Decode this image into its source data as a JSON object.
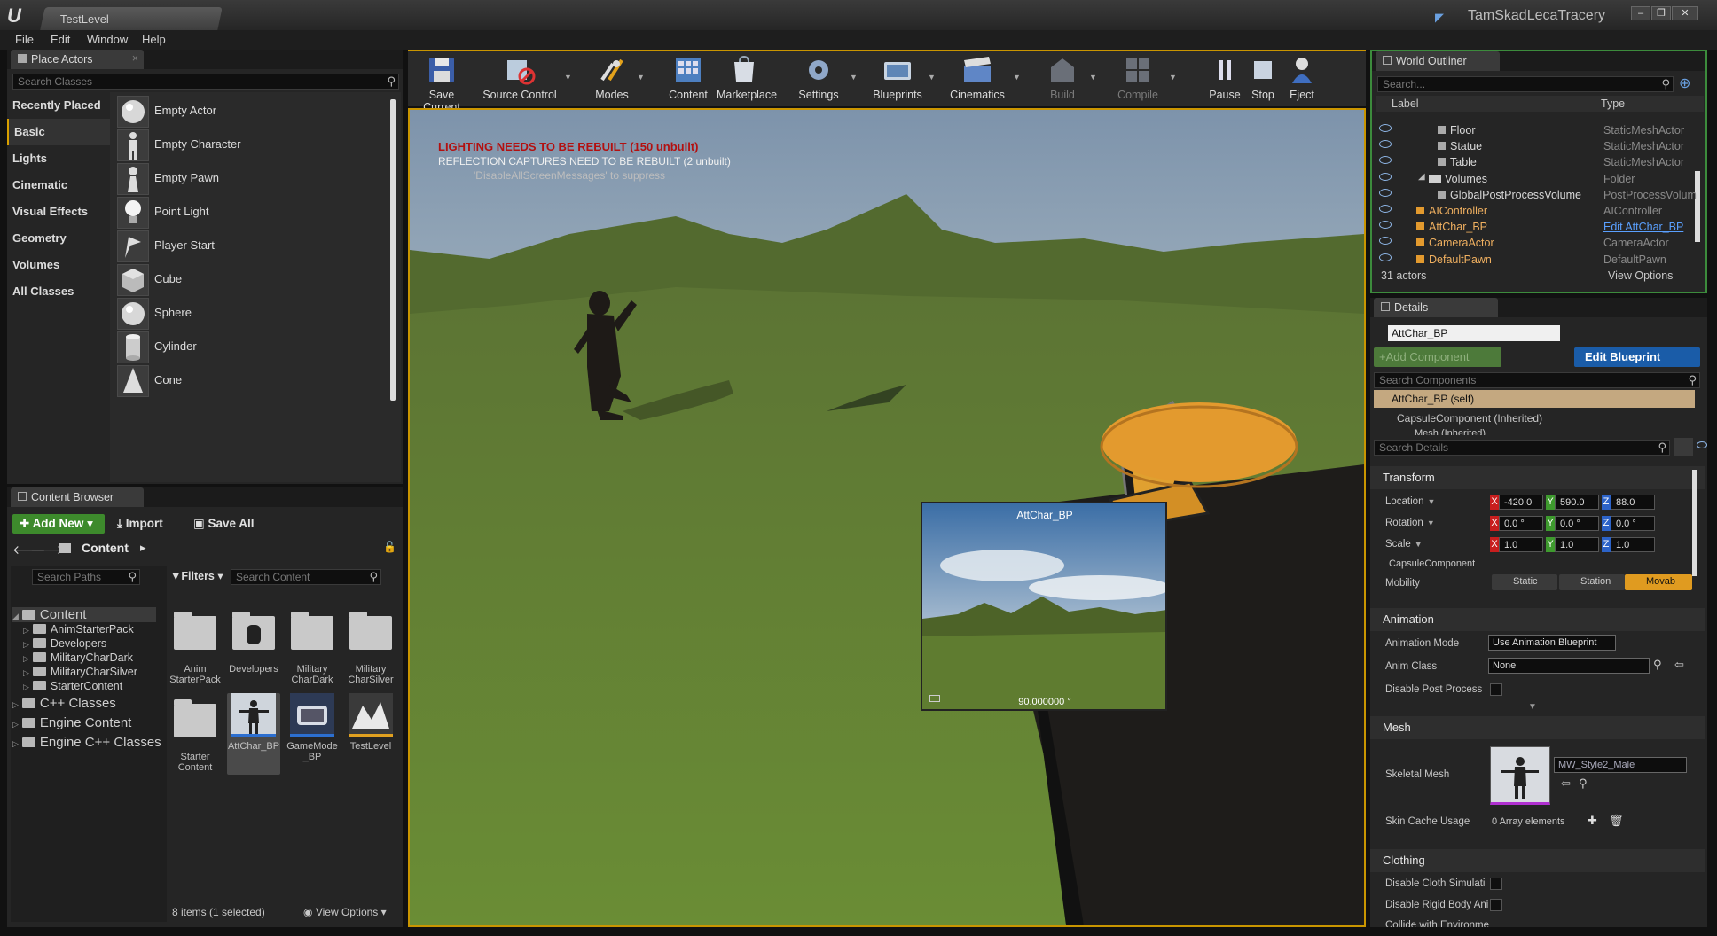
{
  "window": {
    "tab_title": "TestLevel",
    "project_name": "TamSkadLecaTracery",
    "controls": [
      "minimize",
      "maximize",
      "close"
    ]
  },
  "menu": [
    "File",
    "Edit",
    "Window",
    "Help"
  ],
  "place_actors": {
    "tab_label": "Place Actors",
    "search_placeholder": "Search Classes",
    "categories": [
      "Recently Placed",
      "Basic",
      "Lights",
      "Cinematic",
      "Visual Effects",
      "Geometry",
      "Volumes",
      "All Classes"
    ],
    "selected_category": "Basic",
    "items": [
      {
        "label": "Empty Actor",
        "icon": "sphere-icon"
      },
      {
        "label": "Empty Character",
        "icon": "character-icon"
      },
      {
        "label": "Empty Pawn",
        "icon": "pawn-icon"
      },
      {
        "label": "Point Light",
        "icon": "bulb-icon"
      },
      {
        "label": "Player Start",
        "icon": "player-start-icon"
      },
      {
        "label": "Cube",
        "icon": "cube-icon"
      },
      {
        "label": "Sphere",
        "icon": "sphere-icon"
      },
      {
        "label": "Cylinder",
        "icon": "cylinder-icon"
      },
      {
        "label": "Cone",
        "icon": "cone-icon"
      }
    ]
  },
  "toolbar": {
    "buttons": [
      {
        "label": "Save Current",
        "icon": "save-icon"
      },
      {
        "label": "Source Control",
        "icon": "source-control-icon"
      },
      {
        "label": "Modes",
        "icon": "modes-icon"
      },
      {
        "label": "Content",
        "icon": "content-icon"
      },
      {
        "label": "Marketplace",
        "icon": "marketplace-icon"
      },
      {
        "label": "Settings",
        "icon": "settings-icon"
      },
      {
        "label": "Blueprints",
        "icon": "blueprints-icon"
      },
      {
        "label": "Cinematics",
        "icon": "cinematics-icon"
      },
      {
        "label": "Build",
        "icon": "build-icon"
      },
      {
        "label": "Compile",
        "icon": "compile-icon"
      },
      {
        "label": "Pause",
        "icon": "pause-icon"
      },
      {
        "label": "Stop",
        "icon": "stop-icon"
      },
      {
        "label": "Eject",
        "icon": "eject-icon"
      }
    ]
  },
  "viewport": {
    "warning1": "LIGHTING NEEDS TO BE REBUILT (150 unbuilt)",
    "warning2": "REFLECTION CAPTURES NEED TO BE REBUILT (2 unbuilt)",
    "warning3": "'DisableAllScreenMessages' to suppress",
    "preview_title": "AttChar_BP",
    "preview_fov": "90.000000 °",
    "colors": {
      "sky": "#9fb3c4",
      "grass": "#5f7a34",
      "highlight": "#d99a00"
    }
  },
  "world_outliner": {
    "tab_label": "World Outliner",
    "search_placeholder": "Search...",
    "col_label": "Label",
    "col_type": "Type",
    "rows": [
      {
        "label": "Floor",
        "type": "StaticMeshActor",
        "indent": 3
      },
      {
        "label": "Statue",
        "type": "StaticMeshActor",
        "indent": 3
      },
      {
        "label": "Table",
        "type": "StaticMeshActor",
        "indent": 3
      },
      {
        "label": "Volumes",
        "type": "Folder",
        "indent": 2
      },
      {
        "label": "GlobalPostProcessVolume",
        "type": "PostProcessVolum",
        "indent": 3
      },
      {
        "label": "AIController",
        "type": "AIController",
        "indent": 1
      },
      {
        "label": "AttChar_BP",
        "type": "Edit AttChar_BP",
        "indent": 1
      },
      {
        "label": "CameraActor",
        "type": "CameraActor",
        "indent": 1
      },
      {
        "label": "DefaultPawn",
        "type": "DefaultPawn",
        "indent": 1
      }
    ],
    "count": "31 actors",
    "view_options": "View Options"
  },
  "details": {
    "tab_label": "Details",
    "name_value": "AttChar_BP",
    "add_component": "+Add Component",
    "edit_blueprint": "Edit Blueprint",
    "search_components_placeholder": "Search Components",
    "self_row": "AttChar_BP (self)",
    "capsule_row": "CapsuleComponent (Inherited)",
    "mesh_row": "Mesh (Inherited)",
    "search_details_placeholder": "Search Details",
    "transform": {
      "title": "Transform",
      "location_label": "Location",
      "rotation_label": "Rotation",
      "scale_label": "Scale",
      "location": [
        "-420.0",
        "590.0",
        "88.0"
      ],
      "rotation": [
        "0.0 °",
        "0.0 °",
        "0.0 °"
      ],
      "scale": [
        "1.0",
        "1.0",
        "1.0"
      ],
      "sub": "CapsuleComponent",
      "mobility_label": "Mobility",
      "mobility_options": [
        "Static",
        "Station",
        "Movab"
      ],
      "mobility_selected": "Movab"
    },
    "animation": {
      "title": "Animation",
      "mode_label": "Animation Mode",
      "mode_value": "Use Animation Blueprint",
      "class_label": "Anim Class",
      "class_value": "None",
      "disable_pp_label": "Disable Post Process"
    },
    "mesh": {
      "title": "Mesh",
      "skeletal_label": "Skeletal Mesh",
      "skeletal_value": "MW_Style2_Male",
      "skin_cache_label": "Skin Cache Usage",
      "skin_cache_value": "0 Array elements"
    },
    "clothing": {
      "title": "Clothing",
      "row1": "Disable Cloth Simulati",
      "row2": "Disable Rigid Body Ani",
      "row3": "Collide with Environme"
    }
  },
  "content_browser": {
    "tab_label": "Content Browser",
    "add_new": "Add New",
    "import": "Import",
    "save_all": "Save All",
    "path": "Content",
    "search_paths_placeholder": "Search Paths",
    "filters": "Filters",
    "search_content_placeholder": "Search Content",
    "tree": [
      {
        "label": "Content",
        "level": 0
      },
      {
        "label": "AnimStarterPack",
        "level": 1
      },
      {
        "label": "Developers",
        "level": 1
      },
      {
        "label": "MilitaryCharDark",
        "level": 1
      },
      {
        "label": "MilitaryCharSilver",
        "level": 1
      },
      {
        "label": "StarterContent",
        "level": 1
      },
      {
        "label": "C++ Classes",
        "level": 0
      },
      {
        "label": "Engine Content",
        "level": 0
      },
      {
        "label": "Engine C++ Classes",
        "level": 0
      }
    ],
    "assets": [
      {
        "l1": "Anim",
        "l2": "StarterPack",
        "kind": "folder"
      },
      {
        "l1": "Developers",
        "l2": "",
        "kind": "devfolder"
      },
      {
        "l1": "Military",
        "l2": "CharDark",
        "kind": "folder"
      },
      {
        "l1": "Military",
        "l2": "CharSilver",
        "kind": "folder"
      },
      {
        "l1": "Starter",
        "l2": "Content",
        "kind": "folder"
      },
      {
        "l1": "AttChar_BP",
        "l2": "",
        "kind": "blueprint"
      },
      {
        "l1": "GameMode",
        "l2": "_BP",
        "kind": "gamemode"
      },
      {
        "l1": "TestLevel",
        "l2": "",
        "kind": "level"
      }
    ],
    "status": "8 items (1 selected)",
    "view_options": "View Options"
  }
}
